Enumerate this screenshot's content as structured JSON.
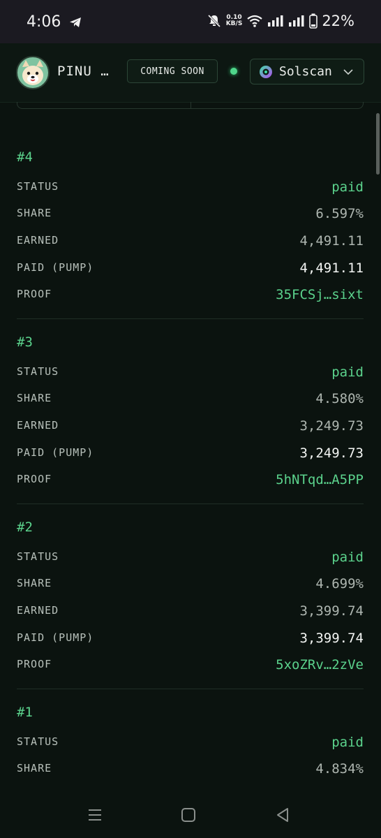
{
  "status_bar": {
    "time": "4:06",
    "speed_value": "0.10",
    "speed_unit": "KB/S",
    "battery": "22%"
  },
  "header": {
    "brand": "PINU …",
    "coming_soon": "COMING SOON",
    "explorer": "Solscan"
  },
  "colors": {
    "accent": "#5bd28c",
    "background": "#0b130f"
  },
  "payouts": [
    {
      "title": "#4",
      "rows": [
        {
          "label": "STATUS",
          "value": "paid"
        },
        {
          "label": "SHARE",
          "value": "6.597%"
        },
        {
          "label": "EARNED",
          "value": "4,491.11"
        },
        {
          "label": "PAID (PUMP)",
          "value": "4,491.11"
        },
        {
          "label": "PROOF",
          "value": "35FCSj…sixt"
        }
      ]
    },
    {
      "title": "#3",
      "rows": [
        {
          "label": "STATUS",
          "value": "paid"
        },
        {
          "label": "SHARE",
          "value": "4.580%"
        },
        {
          "label": "EARNED",
          "value": "3,249.73"
        },
        {
          "label": "PAID (PUMP)",
          "value": "3,249.73"
        },
        {
          "label": "PROOF",
          "value": "5hNTqd…A5PP"
        }
      ]
    },
    {
      "title": "#2",
      "rows": [
        {
          "label": "STATUS",
          "value": "paid"
        },
        {
          "label": "SHARE",
          "value": "4.699%"
        },
        {
          "label": "EARNED",
          "value": "3,399.74"
        },
        {
          "label": "PAID (PUMP)",
          "value": "3,399.74"
        },
        {
          "label": "PROOF",
          "value": "5xoZRv…2zVe"
        }
      ]
    },
    {
      "title": "#1",
      "rows": [
        {
          "label": "STATUS",
          "value": "paid"
        },
        {
          "label": "SHARE",
          "value": "4.834%"
        }
      ]
    }
  ]
}
